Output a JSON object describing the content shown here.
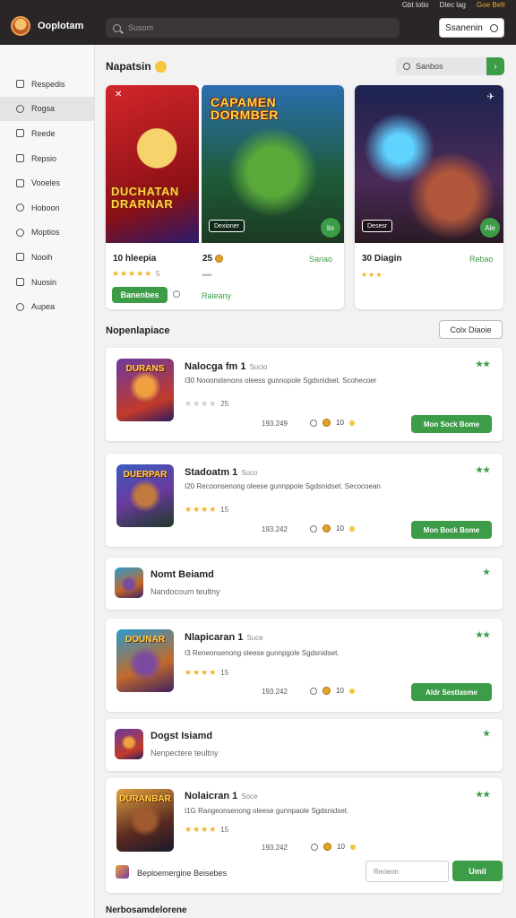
{
  "topbar": {
    "links": [
      "Gbt lotio",
      "Dtec lag",
      "Goe Befr"
    ],
    "brand": "Ooplotam",
    "search_placeholder": "Susom",
    "button_label": "Ssanenin"
  },
  "sidebar": {
    "items": [
      "Respedis",
      "Rogsa",
      "Reede",
      "Repsio",
      "Vooeles",
      "Hoboon",
      "Moptios",
      "Nooih",
      "Nuosin",
      "Aupea"
    ]
  },
  "featured": {
    "title": "Napatsin",
    "filter_label": "Sanbos",
    "cards": [
      {
        "art_title": "DUCHATAN DRARNAR",
        "name": "10 hleepia",
        "rating_text": "5",
        "button": "Banenbes"
      },
      {
        "art_title": "CAPAMEN DORMBER",
        "chip": "Dexioner",
        "badge": "lio",
        "name": "25",
        "green_right": "Sanao",
        "green_below": "Raleany"
      },
      {
        "chip": "Desesr",
        "badge": "Ale",
        "name": "30 Diagin",
        "green_right": "Rebao"
      }
    ]
  },
  "list": {
    "title": "Nopenlapiace",
    "button": "Colx Diaoie",
    "cards": [
      {
        "thumb": "DURANS",
        "title": "Nalocga fm 1",
        "tag": "Sucio",
        "desc": "I30 Nooonstenons oleess gunnopole Sgdsnidset. Scohecoer",
        "stars_filled": 0,
        "rating": "25",
        "date": "193.249",
        "count": "10",
        "rank": "★★",
        "button": "Mon Sock Bome"
      },
      {
        "thumb": "DUERPAR",
        "title": "Stadoatm 1",
        "tag": "Suco",
        "desc": "I20 Recoonsenong oleese gunnppole Sgdsnidset. Secocoean",
        "stars_filled": 4,
        "rating": "15",
        "date": "193.242",
        "count": "10",
        "rank": "★★",
        "button": "Mon Bock Bome"
      },
      {
        "title": "Nomt Beiamd",
        "sub": "Nandocoum teultny",
        "rank": "★"
      },
      {
        "thumb": "DOUNAR",
        "title": "Nlapicaran 1",
        "tag": "Suce",
        "desc": "I3 Reneonsenong oleese gunnpgole Sgdsnidset.",
        "stars_filled": 4,
        "rating": "15",
        "date": "193.242",
        "count": "10",
        "rank": "★★",
        "button": "Aldr Sestlasme"
      },
      {
        "title": "Dogst Isiamd",
        "sub": "Nenpectere teultny",
        "rank": "★"
      },
      {
        "thumb": "DURANBAR",
        "title": "Nolaicran 1",
        "tag": "Soce",
        "desc": "I1G Rangeonsenong oleese gunnpaole Sgdsnidset.",
        "stars_filled": 4,
        "rating": "15",
        "date": "193.242",
        "count": "10",
        "rank": "★★",
        "footer_label": "Beploemergine Beisebes",
        "search": "Reoeon",
        "button": "Umil"
      }
    ]
  },
  "footer_title": "Nerbosamdelorene",
  "colors": {
    "accent": "#3d9c48",
    "topbar": "#2a2628",
    "stars": "#f2b01e"
  }
}
